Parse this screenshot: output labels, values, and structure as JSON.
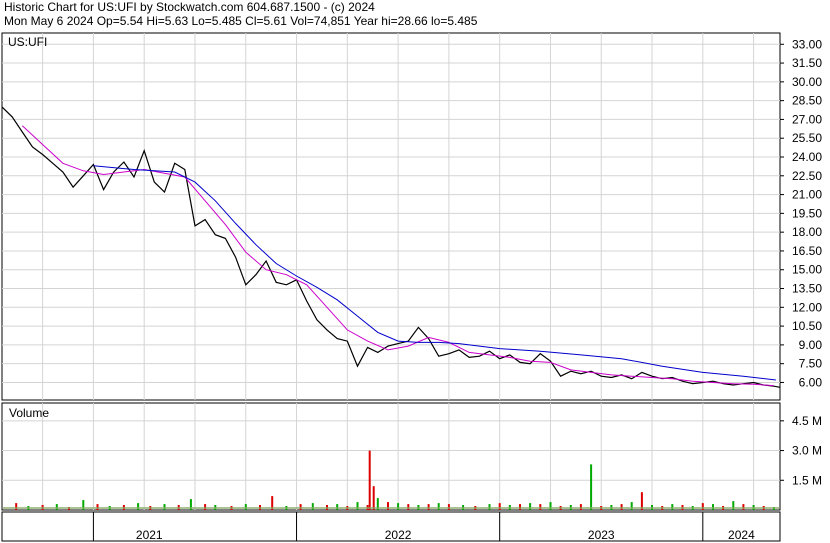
{
  "header": {
    "line1": "Historic Chart for US:UFI by Stockwatch.com 604.687.1500 - (c) 2024",
    "line2": "Mon May  6 2024  Op=5.54  Hi=5.63  Lo=5.485  Cl=5.61  Vol=74,851  Year hi=28.66  lo=5.485"
  },
  "chart_data": [
    {
      "type": "line",
      "title": "US:UFI",
      "x_labels": [
        "2021",
        "2022",
        "2023",
        "2024"
      ],
      "x_label_positions": [
        2021.0,
        2022.0,
        2023.0,
        2024.0
      ],
      "x_range": [
        2020.55,
        2024.38
      ],
      "ylim": [
        4.6,
        33.9
      ],
      "yticks": [
        6.0,
        7.5,
        9.0,
        10.5,
        12.0,
        13.5,
        15.0,
        16.5,
        18.0,
        19.5,
        21.0,
        22.5,
        24.0,
        25.5,
        27.0,
        28.5,
        30.0,
        31.5,
        33.0
      ],
      "ytick_labels": [
        "6.00",
        "7.50",
        "9.00",
        "10.50",
        "12.00",
        "13.50",
        "15.00",
        "16.50",
        "18.00",
        "19.50",
        "21.00",
        "22.50",
        "24.00",
        "25.50",
        "27.00",
        "28.50",
        "30.00",
        "31.50",
        "33.00"
      ],
      "grid": true,
      "series": [
        {
          "color": "#000000",
          "x": [
            2020.55,
            2020.6,
            2020.65,
            2020.7,
            2020.75,
            2020.8,
            2020.85,
            2020.9,
            2020.95,
            2021.0,
            2021.05,
            2021.1,
            2021.15,
            2021.2,
            2021.25,
            2021.3,
            2021.35,
            2021.4,
            2021.45,
            2021.5,
            2021.55,
            2021.6,
            2021.65,
            2021.7,
            2021.75,
            2021.8,
            2021.85,
            2021.9,
            2021.95,
            2022.0,
            2022.05,
            2022.1,
            2022.15,
            2022.2,
            2022.25,
            2022.3,
            2022.35,
            2022.4,
            2022.45,
            2022.5,
            2022.55,
            2022.6,
            2022.65,
            2022.7,
            2022.75,
            2022.8,
            2022.85,
            2022.9,
            2022.95,
            2023.0,
            2023.05,
            2023.1,
            2023.15,
            2023.2,
            2023.25,
            2023.3,
            2023.35,
            2023.4,
            2023.45,
            2023.5,
            2023.55,
            2023.6,
            2023.65,
            2023.7,
            2023.75,
            2023.8,
            2023.85,
            2023.9,
            2023.95,
            2024.0,
            2024.05,
            2024.1,
            2024.15,
            2024.2,
            2024.25,
            2024.3,
            2024.35,
            2024.38
          ],
          "y": [
            28.0,
            27.2,
            26.0,
            24.8,
            24.2,
            23.5,
            22.8,
            21.6,
            22.5,
            23.4,
            21.4,
            22.8,
            23.6,
            22.4,
            24.5,
            22.0,
            21.2,
            23.5,
            23.0,
            18.5,
            19.0,
            17.8,
            17.5,
            16.0,
            13.8,
            14.6,
            15.7,
            14.0,
            13.8,
            14.2,
            12.5,
            11.0,
            10.2,
            9.5,
            9.3,
            7.3,
            8.8,
            8.4,
            8.9,
            9.1,
            9.3,
            10.4,
            9.5,
            8.1,
            8.3,
            8.6,
            8.0,
            8.1,
            8.5,
            7.9,
            8.2,
            7.6,
            7.5,
            8.3,
            7.7,
            6.5,
            6.9,
            6.7,
            6.9,
            6.5,
            6.4,
            6.6,
            6.3,
            6.8,
            6.5,
            6.3,
            6.4,
            6.1,
            5.9,
            6.0,
            6.1,
            5.9,
            5.8,
            5.9,
            6.0,
            5.8,
            5.7,
            5.61
          ]
        },
        {
          "color": "#cc00cc",
          "x": [
            2020.65,
            2020.75,
            2020.85,
            2020.95,
            2021.05,
            2021.15,
            2021.25,
            2021.35,
            2021.45,
            2021.55,
            2021.65,
            2021.75,
            2021.85,
            2021.95,
            2022.05,
            2022.15,
            2022.25,
            2022.35,
            2022.45,
            2022.55,
            2022.65,
            2022.75,
            2022.85,
            2022.95,
            2023.05,
            2023.15,
            2023.25,
            2023.35,
            2023.45,
            2023.55,
            2023.65,
            2023.75,
            2023.85,
            2023.95,
            2024.05,
            2024.15,
            2024.25,
            2024.35
          ],
          "y": [
            26.5,
            25.0,
            23.5,
            22.9,
            22.6,
            22.8,
            23.0,
            22.7,
            22.4,
            20.5,
            18.6,
            16.4,
            15.0,
            14.6,
            13.8,
            12.0,
            10.2,
            9.3,
            8.6,
            8.9,
            9.6,
            9.2,
            8.4,
            8.2,
            8.0,
            7.7,
            7.6,
            7.0,
            6.8,
            6.6,
            6.5,
            6.4,
            6.3,
            6.1,
            6.0,
            5.9,
            5.85,
            5.75
          ]
        },
        {
          "color": "#0000cc",
          "x": [
            2021.0,
            2021.2,
            2021.4,
            2021.5,
            2021.6,
            2021.7,
            2021.8,
            2021.9,
            2022.0,
            2022.1,
            2022.2,
            2022.3,
            2022.4,
            2022.5,
            2022.6,
            2022.7,
            2022.8,
            2022.9,
            2023.0,
            2023.2,
            2023.4,
            2023.6,
            2023.8,
            2024.0,
            2024.2,
            2024.36
          ],
          "y": [
            23.3,
            23.0,
            22.8,
            22.0,
            20.5,
            18.7,
            17.0,
            15.5,
            14.5,
            13.6,
            12.6,
            11.3,
            10.0,
            9.3,
            9.2,
            9.2,
            9.1,
            8.9,
            8.7,
            8.5,
            8.2,
            7.9,
            7.3,
            6.8,
            6.5,
            6.2
          ]
        }
      ]
    },
    {
      "type": "bar",
      "title": "Volume",
      "ylim": [
        0,
        5.4
      ],
      "yticks": [
        1.5,
        3.0,
        4.5
      ],
      "ytick_labels": [
        "1.5 M",
        "3.0 M",
        "4.5 M"
      ],
      "x_range": [
        2020.55,
        2024.38
      ],
      "spikes": {
        "x": [
          2020.62,
          2020.68,
          2020.75,
          2020.82,
          2020.88,
          2020.95,
          2021.02,
          2021.08,
          2021.15,
          2021.22,
          2021.28,
          2021.35,
          2021.42,
          2021.48,
          2021.55,
          2021.6,
          2021.68,
          2021.75,
          2021.82,
          2021.88,
          2021.95,
          2022.02,
          2022.08,
          2022.15,
          2022.2,
          2022.25,
          2022.3,
          2022.35,
          2022.36,
          2022.38,
          2022.4,
          2022.45,
          2022.5,
          2022.55,
          2022.6,
          2022.65,
          2022.7,
          2022.75,
          2022.82,
          2022.88,
          2022.95,
          2023.0,
          2023.05,
          2023.1,
          2023.15,
          2023.2,
          2023.25,
          2023.3,
          2023.35,
          2023.4,
          2023.45,
          2023.5,
          2023.55,
          2023.6,
          2023.65,
          2023.7,
          2023.75,
          2023.8,
          2023.85,
          2023.9,
          2023.95,
          2024.0,
          2024.05,
          2024.1,
          2024.15,
          2024.2,
          2024.25,
          2024.3,
          2024.35
        ],
        "v": [
          0.35,
          0.2,
          0.25,
          0.3,
          0.15,
          0.5,
          0.3,
          0.2,
          0.25,
          0.35,
          0.2,
          0.3,
          0.25,
          0.55,
          0.3,
          0.25,
          0.2,
          0.3,
          0.25,
          0.7,
          0.2,
          0.3,
          0.35,
          0.25,
          0.3,
          0.2,
          0.4,
          0.25,
          3.0,
          1.2,
          0.6,
          0.4,
          0.35,
          0.3,
          0.25,
          0.3,
          0.35,
          0.3,
          0.25,
          0.2,
          0.3,
          0.35,
          0.25,
          0.3,
          0.35,
          0.3,
          0.4,
          0.2,
          0.25,
          0.3,
          2.3,
          0.2,
          0.25,
          0.3,
          0.4,
          0.9,
          0.25,
          0.2,
          0.3,
          0.25,
          0.2,
          0.35,
          0.3,
          0.2,
          0.45,
          0.3,
          0.25,
          0.2,
          0.15
        ],
        "c": [
          "r",
          "g",
          "r",
          "g",
          "r",
          "g",
          "r",
          "g",
          "r",
          "g",
          "r",
          "g",
          "r",
          "g",
          "r",
          "g",
          "r",
          "g",
          "r",
          "r",
          "g",
          "r",
          "g",
          "r",
          "g",
          "r",
          "g",
          "r",
          "r",
          "r",
          "g",
          "r",
          "g",
          "r",
          "g",
          "r",
          "g",
          "r",
          "g",
          "r",
          "g",
          "r",
          "g",
          "r",
          "g",
          "r",
          "g",
          "r",
          "g",
          "r",
          "g",
          "r",
          "g",
          "r",
          "g",
          "r",
          "g",
          "r",
          "g",
          "r",
          "g",
          "r",
          "g",
          "r",
          "g",
          "r",
          "g",
          "r",
          "g"
        ]
      }
    }
  ]
}
